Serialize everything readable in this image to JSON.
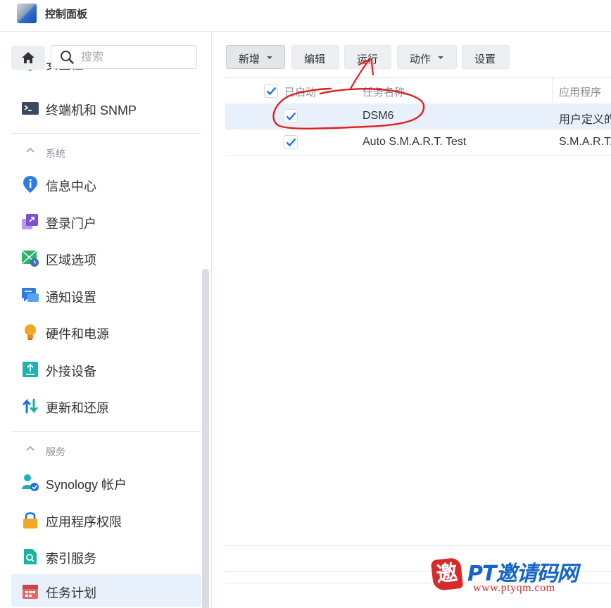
{
  "window": {
    "title": "控制面板"
  },
  "sidebar": {
    "search_placeholder": "搜索",
    "items_top": [
      {
        "label": "安全性"
      },
      {
        "label": "终端机和 SNMP"
      }
    ],
    "sections": [
      {
        "title": "系统",
        "items": [
          {
            "label": "信息中心"
          },
          {
            "label": "登录门户"
          },
          {
            "label": "区域选项"
          },
          {
            "label": "通知设置"
          },
          {
            "label": "硬件和电源"
          },
          {
            "label": "外接设备"
          },
          {
            "label": "更新和还原"
          }
        ]
      },
      {
        "title": "服务",
        "items": [
          {
            "label": "Synology 帐户"
          },
          {
            "label": "应用程序权限"
          },
          {
            "label": "索引服务"
          },
          {
            "label": "任务计划",
            "active": true
          }
        ]
      }
    ]
  },
  "toolbar": {
    "create_label": "新增",
    "edit_label": "编辑",
    "run_label": "运行",
    "action_label": "动作",
    "settings_label": "设置"
  },
  "table": {
    "columns": [
      "已启动",
      "任务名称",
      "应用程序"
    ],
    "rows": [
      {
        "enabled": true,
        "name": "DSM6",
        "app": "用户定义的",
        "selected": true
      },
      {
        "enabled": true,
        "name": "Auto S.M.A.R.T. Test",
        "app": "S.M.A.R.T."
      }
    ]
  },
  "watermark": {
    "badge": "邀",
    "title": "PT邀请码网",
    "url": "www.ptyqm.com"
  },
  "colors": {
    "accent": "#1a73e8",
    "selected_row": "#e8f0fc",
    "annotation": "#e02020"
  }
}
